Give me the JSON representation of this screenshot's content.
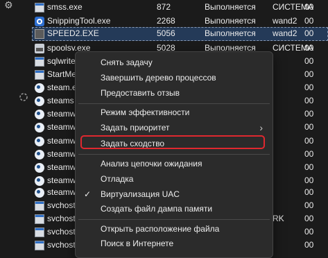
{
  "processes": [
    {
      "name": "smss.exe",
      "pid": "872",
      "status": "Выполняется",
      "user": "СИСТЕМА",
      "cpu": "00",
      "icon": "exe-icon"
    },
    {
      "name": "SnippingTool.exe",
      "pid": "2268",
      "status": "Выполняется",
      "user": "wand2",
      "cpu": "00",
      "icon": "snipping-tool-icon"
    },
    {
      "name": "SPEED2.EXE",
      "pid": "5056",
      "status": "Выполняется",
      "user": "wand2",
      "cpu": "00",
      "icon": "speed2-icon"
    },
    {
      "name": "spoolsv.exe",
      "pid": "5028",
      "status": "Выполняется",
      "user": "СИСТЕМА",
      "cpu": "00",
      "icon": "printer-icon"
    },
    {
      "name": "sqlwrite",
      "pid": "",
      "status": "",
      "user": "",
      "cpu": "00",
      "icon": "exe-icon"
    },
    {
      "name": "StartMe",
      "pid": "",
      "status": "",
      "user": "",
      "cpu": "00",
      "icon": "exe-icon"
    },
    {
      "name": "steam.e",
      "pid": "",
      "status": "",
      "user": "",
      "cpu": "00",
      "icon": "steam-icon"
    },
    {
      "name": "steams",
      "pid": "",
      "status": "",
      "user": "",
      "cpu": "00",
      "icon": "steam-icon"
    },
    {
      "name": "steamw",
      "pid": "",
      "status": "",
      "user": "",
      "cpu": "00",
      "icon": "steam-icon"
    },
    {
      "name": "steamw",
      "pid": "",
      "status": "",
      "user": "",
      "cpu": "00",
      "icon": "steam-icon"
    },
    {
      "name": "steamw",
      "pid": "",
      "status": "",
      "user": "",
      "cpu": "00",
      "icon": "steam-icon"
    },
    {
      "name": "steamw",
      "pid": "",
      "status": "",
      "user": "",
      "cpu": "00",
      "icon": "steam-icon"
    },
    {
      "name": "steamw",
      "pid": "",
      "status": "",
      "user": "",
      "cpu": "00",
      "icon": "steam-icon"
    },
    {
      "name": "steamw",
      "pid": "",
      "status": "",
      "user": "",
      "cpu": "00",
      "icon": "steam-icon"
    },
    {
      "name": "steamw",
      "pid": "",
      "status": "",
      "user": "",
      "cpu": "00",
      "icon": "steam-icon"
    },
    {
      "name": "svchost",
      "pid": "",
      "status": "",
      "user": "",
      "cpu": "00",
      "icon": "exe-icon"
    },
    {
      "name": "svchost",
      "pid": "",
      "status": "",
      "user": "RK",
      "cpu": "00",
      "icon": "exe-icon"
    },
    {
      "name": "svchost",
      "pid": "",
      "status": "",
      "user": "",
      "cpu": "00",
      "icon": "exe-icon"
    },
    {
      "name": "svchost",
      "pid": "",
      "status": "",
      "user": "",
      "cpu": "00",
      "icon": "exe-icon"
    }
  ],
  "context_menu": {
    "items": [
      {
        "label": "Снять задачу"
      },
      {
        "label": "Завершить дерево процессов"
      },
      {
        "label": "Предоставить отзыв"
      },
      {
        "label": "Режим эффективности"
      },
      {
        "label": "Задать приоритет",
        "submenu_arrow": "›"
      },
      {
        "label": "Задать сходство"
      },
      {
        "label": "Анализ цепочки ожидания"
      },
      {
        "label": "Отладка"
      },
      {
        "label": "Виртуализация UAC",
        "check": "✓"
      },
      {
        "label": "Создать файл дампа памяти"
      },
      {
        "label": "Открыть расположение файла"
      },
      {
        "label": "Поиск в Интернете"
      }
    ]
  },
  "colors": {
    "background": "#1b1b1b",
    "menu_background": "#2b2b2b",
    "selected_row": "#243a58",
    "highlight_border": "#e0282f"
  }
}
